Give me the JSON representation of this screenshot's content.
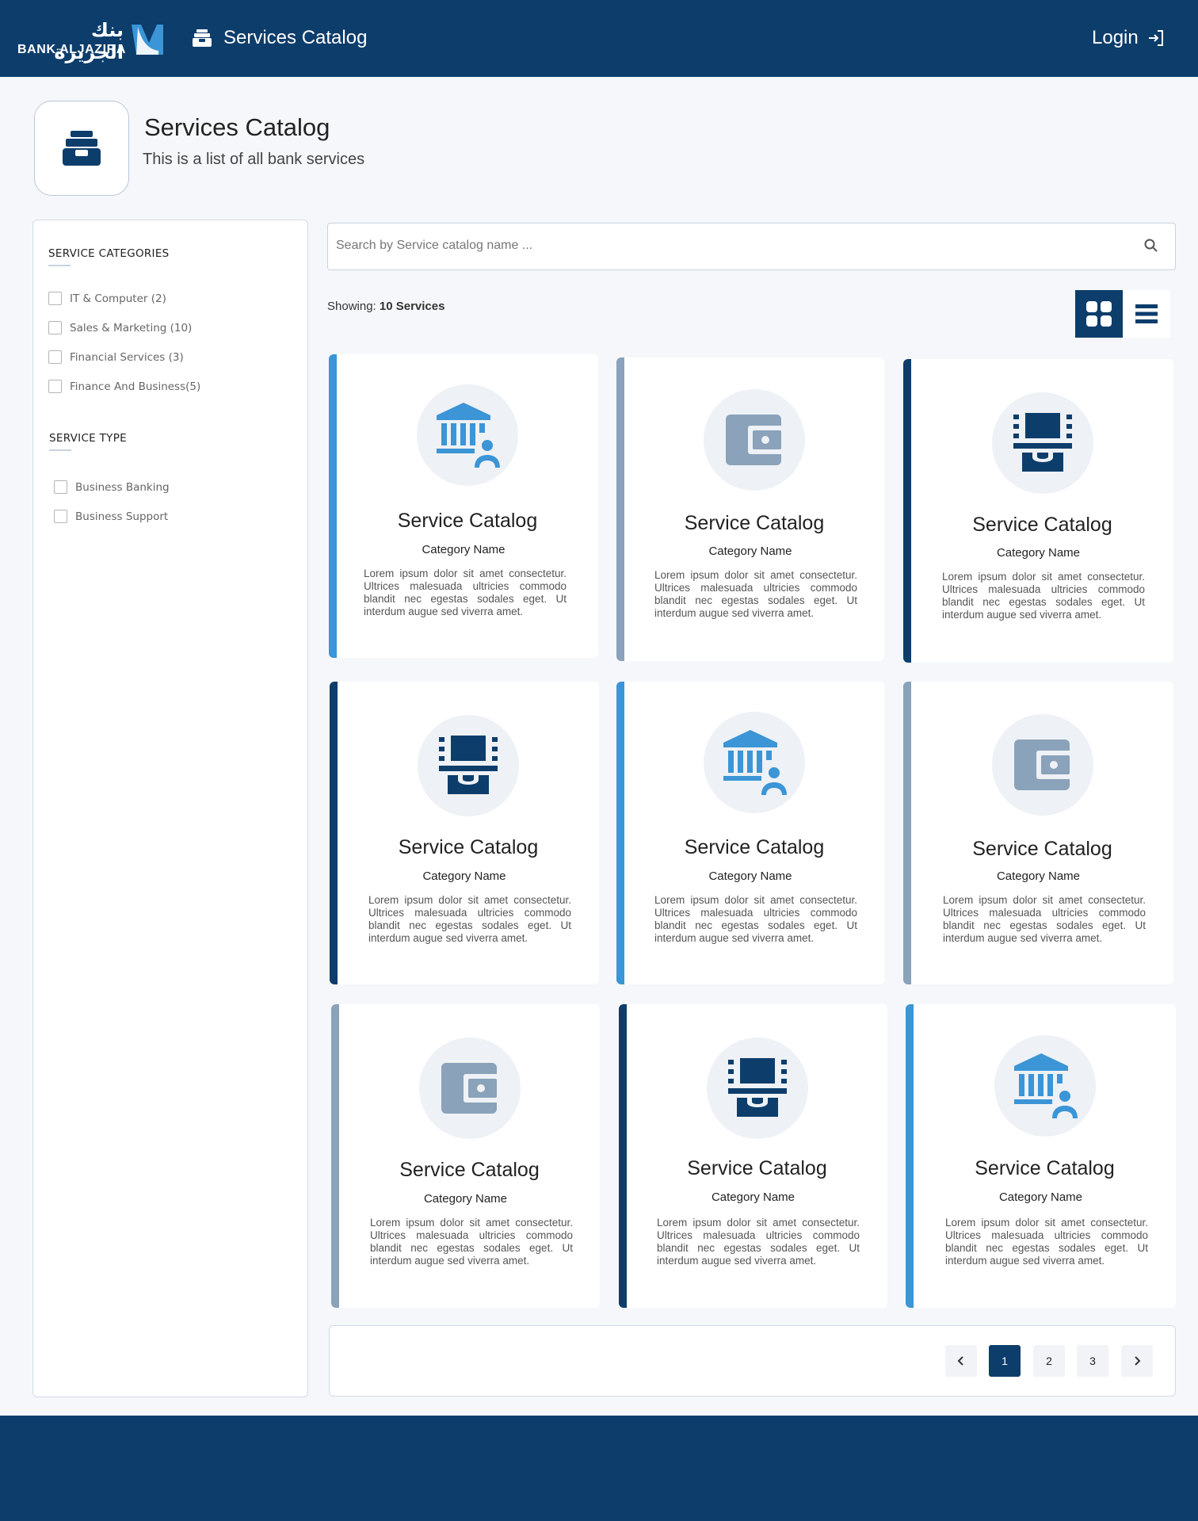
{
  "brand": {
    "arabic_name": "بنك الجزيرة",
    "english_name": "BANK ALJAZIRA"
  },
  "nav": {
    "title": "Services Catalog",
    "login_label": "Login"
  },
  "header": {
    "title": "Services Catalog",
    "subtitle": "This is a list of all bank services"
  },
  "sidebar": {
    "categories_heading": "SERVICE CATEGORIES",
    "categories": [
      {
        "label": "IT & Computer (2)",
        "checked": false
      },
      {
        "label": "Sales & Marketing (10)",
        "checked": false
      },
      {
        "label": "Financial Services (3)",
        "checked": false
      },
      {
        "label": "Finance And Business(5)",
        "checked": false
      }
    ],
    "type_heading": "SERVICE TYPE",
    "types": [
      {
        "label": "Business Banking",
        "checked": false
      },
      {
        "label": "Business Support",
        "checked": false
      }
    ]
  },
  "search": {
    "placeholder": "Search by Service catalog name ...",
    "value": ""
  },
  "results": {
    "showing_label": "Showing:",
    "showing_count": "10 Services"
  },
  "view": {
    "selected": "grid"
  },
  "colors": {
    "navy": "#0d3d6b",
    "blue": "#3b95d6",
    "slate": "#8aa2ba"
  },
  "cards": [
    {
      "title": "Service Catalog",
      "category": "Category Name",
      "description": "Lorem ipsum dolor sit amet consectetur. Ultrices malesuada ultricies commodo blandit nec egestas sodales eget. Ut interdum augue sed viverra amet.",
      "icon": "bank-user-icon",
      "accent": "#3b95d6"
    },
    {
      "title": "Service Catalog",
      "category": "Category Name",
      "description": "Lorem ipsum dolor sit amet consectetur. Ultrices malesuada ultricies commodo blandit nec egestas sodales eget. Ut interdum augue sed viverra amet.",
      "icon": "wallet-icon",
      "accent": "#8aa2ba"
    },
    {
      "title": "Service Catalog",
      "category": "Category Name",
      "description": "Lorem ipsum dolor sit amet consectetur. Ultrices malesuada ultricies commodo blandit nec egestas sodales eget. Ut interdum augue sed viverra amet.",
      "icon": "atm-icon",
      "accent": "#0d3d6b"
    },
    {
      "title": "Service Catalog",
      "category": "Category Name",
      "description": "Lorem ipsum dolor sit amet consectetur. Ultrices malesuada ultricies commodo blandit nec egestas sodales eget. Ut interdum augue sed viverra amet.",
      "icon": "atm-icon",
      "accent": "#0d3d6b"
    },
    {
      "title": "Service Catalog",
      "category": "Category Name",
      "description": "Lorem ipsum dolor sit amet consectetur. Ultrices malesuada ultricies commodo blandit nec egestas sodales eget. Ut interdum augue sed viverra amet.",
      "icon": "bank-user-icon",
      "accent": "#3b95d6"
    },
    {
      "title": "Service Catalog",
      "category": "Category Name",
      "description": "Lorem ipsum dolor sit amet consectetur. Ultrices malesuada ultricies commodo blandit nec egestas sodales eget. Ut interdum augue sed viverra amet.",
      "icon": "wallet-icon",
      "accent": "#8aa2ba"
    },
    {
      "title": "Service Catalog",
      "category": "Category Name",
      "description": "Lorem ipsum dolor sit amet consectetur. Ultrices malesuada ultricies commodo blandit nec egestas sodales eget. Ut interdum augue sed viverra amet.",
      "icon": "wallet-icon",
      "accent": "#8aa2ba"
    },
    {
      "title": "Service Catalog",
      "category": "Category Name",
      "description": "Lorem ipsum dolor sit amet consectetur. Ultrices malesuada ultricies commodo blandit nec egestas sodales eget. Ut interdum augue sed viverra amet.",
      "icon": "atm-icon",
      "accent": "#0d3d6b"
    },
    {
      "title": "Service Catalog",
      "category": "Category Name",
      "description": "Lorem ipsum dolor sit amet consectetur. Ultrices malesuada ultricies commodo blandit nec egestas sodales eget. Ut interdum augue sed viverra amet.",
      "icon": "bank-user-icon",
      "accent": "#3b95d6"
    }
  ],
  "pagination": {
    "pages": [
      "1",
      "2",
      "3"
    ],
    "current": "1"
  }
}
